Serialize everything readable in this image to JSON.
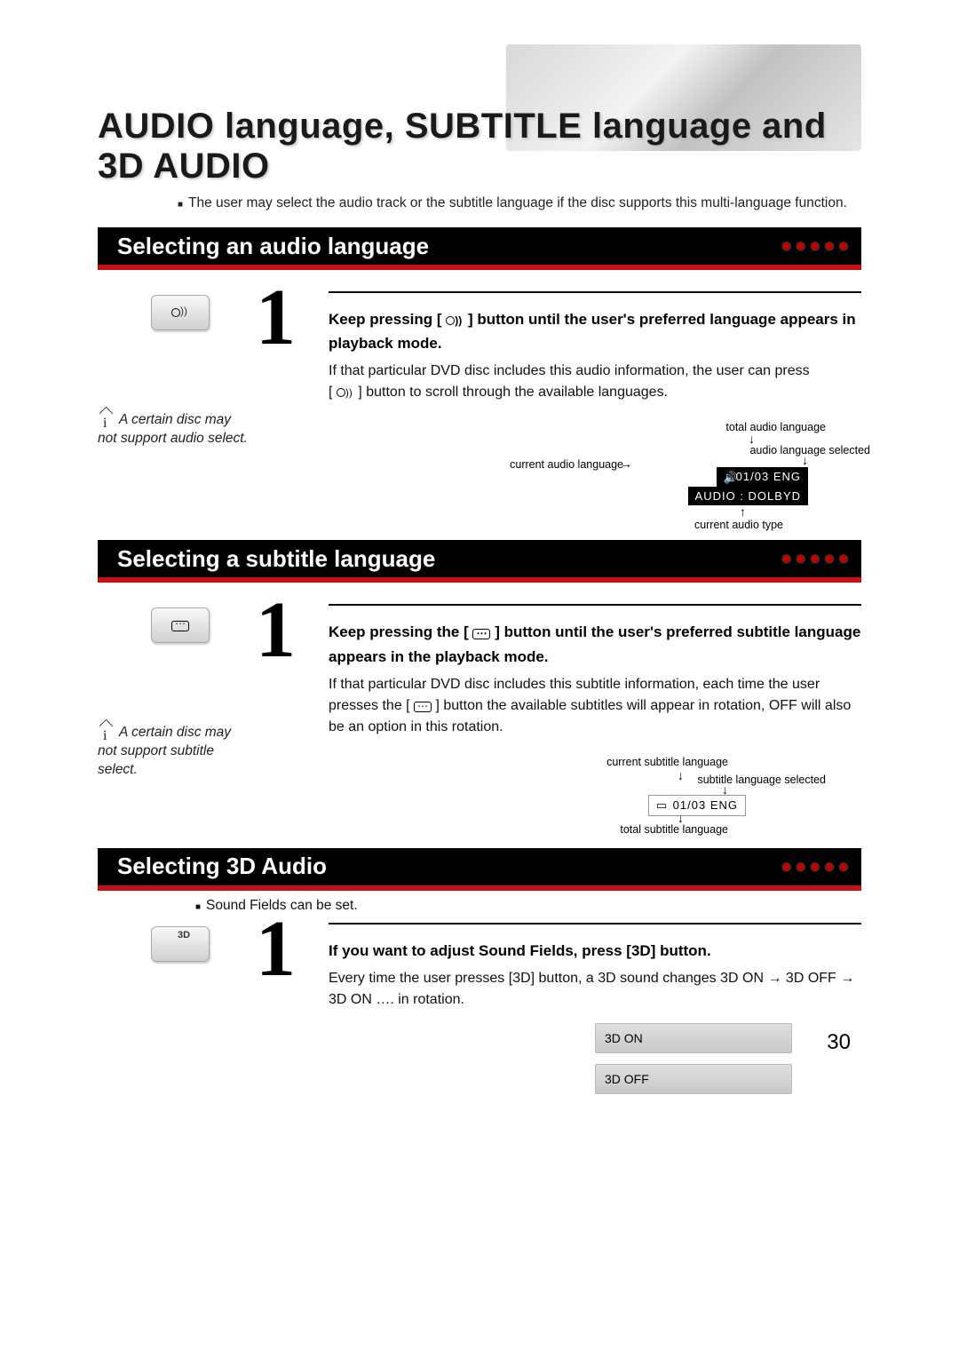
{
  "page": {
    "title": "AUDIO language, SUBTITLE language and 3D AUDIO",
    "intro": "The user may select the audio track or the subtitle language if the disc supports this multi-language function.",
    "number": "30"
  },
  "audio": {
    "bar_title": "Selecting an audio language",
    "step_bold_a": "Keep pressing  [ ",
    "step_bold_b": " ] button until the user's preferred language appears in playback mode.",
    "body_a": "If that particular DVD disc includes this audio information, the user can press",
    "body_b": "[ ",
    "body_c": " ] button to scroll through the available languages.",
    "note": "A certain disc may not support audio select.",
    "diagram": {
      "total": "total audio language",
      "selected": "audio language selected",
      "current_lang": "current audio language",
      "current_type": "current audio type",
      "osd_top": "01/03 ENG",
      "osd_bottom": "AUDIO : DOLBYD"
    }
  },
  "subtitle": {
    "bar_title": "Selecting a subtitle language",
    "step_bold_a": "Keep pressing the [ ",
    "step_bold_b": " ] button until the user's preferred subtitle language appears in the playback mode.",
    "body_a": "If that particular DVD disc includes this subtitle information, each time the user presses the [ ",
    "body_b": " ] button the available subtitles will appear in rotation, OFF will also be an option in this rotation.",
    "note": "A certain disc may not support subtitle select.",
    "diagram": {
      "current_lang": "current subtitle language",
      "selected": "subtitle language selected",
      "total": "total subtitle language",
      "osd": "01/03 ENG"
    }
  },
  "threed": {
    "bar_title": "Selecting 3D Audio",
    "button_label": "3D",
    "note": "Sound Fields can be set.",
    "step_bold": "If you want to adjust Sound Fields, press [3D] button.",
    "body": "Every time the user presses [3D] button, a 3D sound changes 3D ON  →  3D OFF  →  3D ON …. in rotation.",
    "osd_on": "3D ON",
    "osd_off": "3D OFF"
  }
}
